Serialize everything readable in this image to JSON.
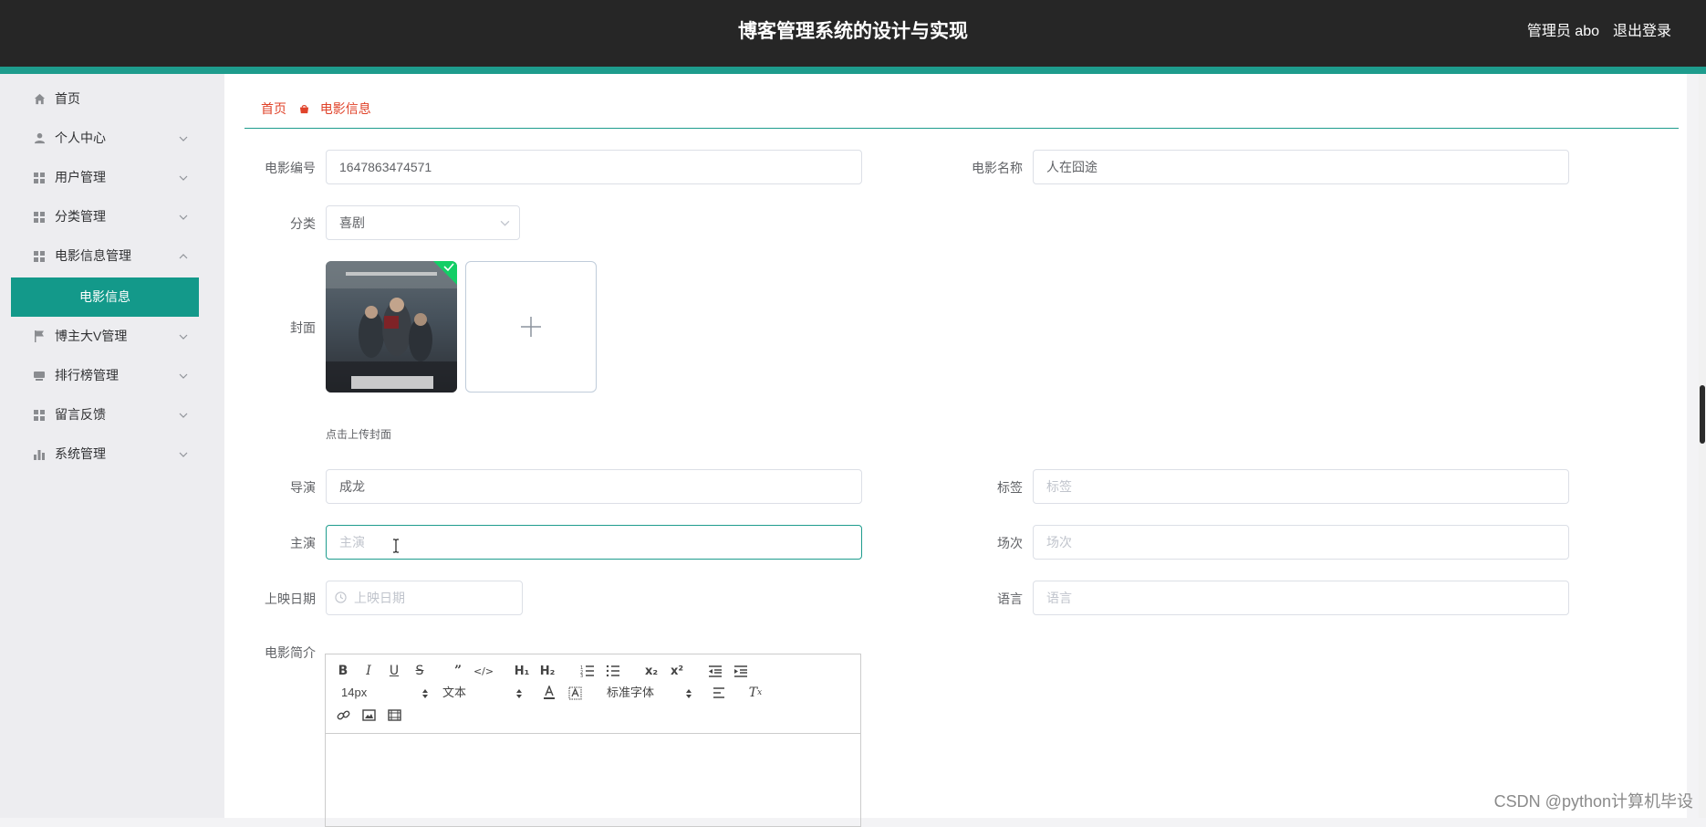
{
  "header": {
    "title": "博客管理系统的设计与实现",
    "user": "管理员 abo",
    "logout": "退出登录"
  },
  "sidebar": {
    "items": [
      {
        "label": "首页",
        "icon": "home-icon"
      },
      {
        "label": "个人中心",
        "icon": "user-icon"
      },
      {
        "label": "用户管理",
        "icon": "grid-icon"
      },
      {
        "label": "分类管理",
        "icon": "grid-icon"
      },
      {
        "label": "电影信息管理",
        "icon": "grid-icon"
      },
      {
        "label": "电影信息",
        "active": true
      },
      {
        "label": "博主大V管理",
        "icon": "flag-icon"
      },
      {
        "label": "排行榜管理",
        "icon": "book-icon"
      },
      {
        "label": "留言反馈",
        "icon": "grid-icon"
      },
      {
        "label": "系统管理",
        "icon": "bar-chart-icon"
      }
    ]
  },
  "breadcrumb": {
    "home": "首页",
    "current": "电影信息"
  },
  "form": {
    "movie_no": {
      "label": "电影编号",
      "value": "1647863474571"
    },
    "movie_name": {
      "label": "电影名称",
      "value": "人在囧途"
    },
    "category": {
      "label": "分类",
      "value": "喜剧"
    },
    "cover": {
      "label": "封面",
      "tip": "点击上传封面"
    },
    "director": {
      "label": "导演",
      "value": "成龙"
    },
    "tags": {
      "label": "标签",
      "placeholder": "标签"
    },
    "actors": {
      "label": "主演",
      "placeholder": "主演"
    },
    "showtimes": {
      "label": "场次",
      "placeholder": "场次"
    },
    "release_date": {
      "label": "上映日期",
      "placeholder": "上映日期"
    },
    "language": {
      "label": "语言",
      "placeholder": "语言"
    },
    "synopsis": {
      "label": "电影简介"
    }
  },
  "editor": {
    "font_size": "14px",
    "text_style": "文本",
    "font_family": "标准字体"
  },
  "watermark": "CSDN @python计算机毕设",
  "colors": {
    "header_bg": "#262626",
    "accent": "#1e9c8d",
    "breadcrumb": "#e0432a"
  }
}
